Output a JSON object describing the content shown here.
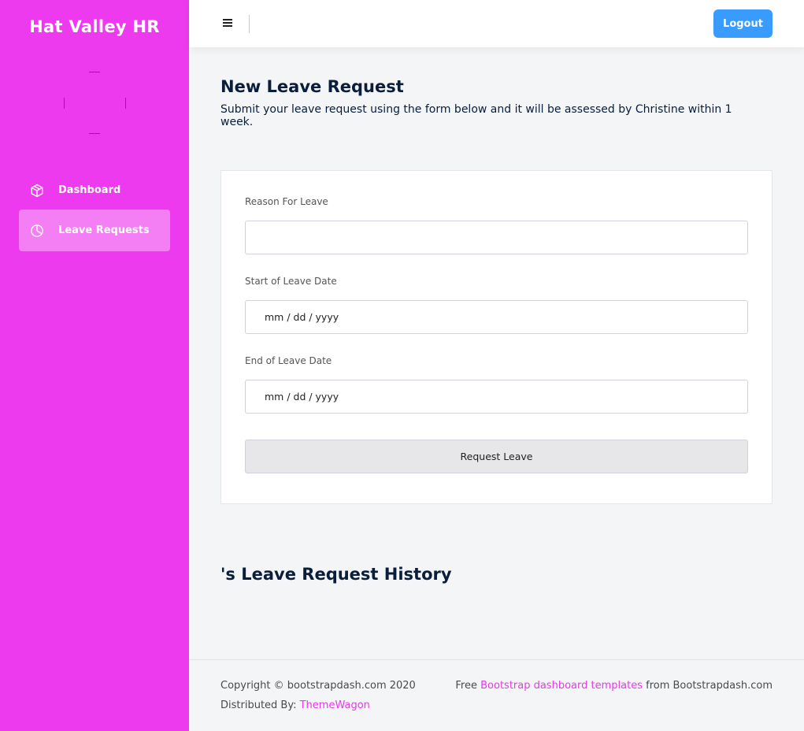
{
  "sidebar": {
    "brand": "Hat Valley HR",
    "items": [
      {
        "label": "Dashboard",
        "icon": "box-icon",
        "active": false
      },
      {
        "label": "Leave Requests",
        "icon": "pie-chart-icon",
        "active": true
      }
    ]
  },
  "topbar": {
    "menu_icon": "hamburger-icon",
    "logout_label": "Logout"
  },
  "main": {
    "title": "New Leave Request",
    "subtitle": "Submit your leave request using the form below and it will be assessed by Christine within 1 week.",
    "form": {
      "reason_label": "Reason For Leave",
      "reason_value": "",
      "start_label": "Start of Leave Date",
      "start_placeholder": "mm / dd / yyyy",
      "end_label": "End of Leave Date",
      "end_placeholder": "mm / dd / yyyy",
      "submit_label": "Request Leave"
    },
    "history_title": "'s Leave Request History"
  },
  "footer": {
    "copyright": "Copyright © bootstrapdash.com 2020",
    "distributed_prefix": "Distributed By: ",
    "distributed_link": "ThemeWagon",
    "free_prefix": "Free ",
    "free_link": "Bootstrap dashboard templates",
    "free_suffix": " from Bootstrapdash.com"
  },
  "colors": {
    "sidebar": "#ee3aee",
    "sidebar_active": "#f47ff4",
    "accent_button": "#3a9bff",
    "link": "#e73ae7"
  }
}
